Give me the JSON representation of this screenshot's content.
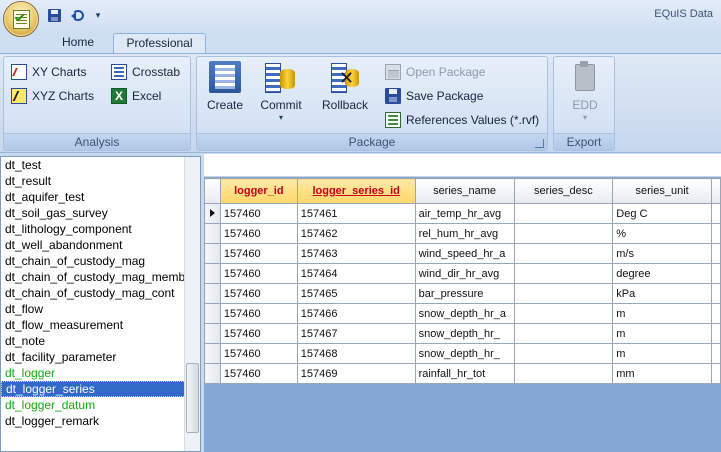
{
  "app": {
    "title": "EQuIS Data",
    "qat_more": "▾"
  },
  "tabs": [
    {
      "label": "Home"
    },
    {
      "label": "Professional"
    }
  ],
  "ribbon": {
    "analysis": {
      "label": "Analysis",
      "xy_charts": "XY Charts",
      "xyz_charts": "XYZ Charts",
      "crosstab": "Crosstab",
      "excel": "Excel"
    },
    "package": {
      "label": "Package",
      "create": "Create",
      "commit": "Commit",
      "commit_arrow": "▾",
      "rollback": "Rollback",
      "open_package": "Open Package",
      "save_package": "Save Package",
      "references_values": "References Values (*.rvf)"
    },
    "export": {
      "label": "Export",
      "edd": "EDD",
      "edd_arrow": "▾"
    }
  },
  "table_list": {
    "items": [
      {
        "label": "dt_test",
        "style": "normal"
      },
      {
        "label": "dt_result",
        "style": "normal"
      },
      {
        "label": "dt_aquifer_test",
        "style": "normal"
      },
      {
        "label": "dt_soil_gas_survey",
        "style": "normal"
      },
      {
        "label": "dt_lithology_component",
        "style": "normal"
      },
      {
        "label": "dt_well_abandonment",
        "style": "normal"
      },
      {
        "label": "dt_chain_of_custody_mag",
        "style": "normal"
      },
      {
        "label": "dt_chain_of_custody_mag_membe",
        "style": "normal"
      },
      {
        "label": "dt_chain_of_custody_mag_cont",
        "style": "normal"
      },
      {
        "label": "dt_flow",
        "style": "normal"
      },
      {
        "label": "dt_flow_measurement",
        "style": "normal"
      },
      {
        "label": "dt_note",
        "style": "normal"
      },
      {
        "label": "dt_facility_parameter",
        "style": "normal"
      },
      {
        "label": "dt_logger",
        "style": "green"
      },
      {
        "label": "dt_logger_series",
        "style": "selected"
      },
      {
        "label": "dt_logger_datum",
        "style": "green"
      },
      {
        "label": "dt_logger_remark",
        "style": "normal"
      }
    ]
  },
  "grid": {
    "columns": [
      "logger_id",
      "logger_series_id",
      "series_name",
      "series_desc",
      "series_unit"
    ],
    "current_row": 0,
    "rows": [
      [
        "157460",
        "157461",
        "air_temp_hr_avg",
        "",
        "Deg C"
      ],
      [
        "157460",
        "157462",
        "rel_hum_hr_avg",
        "",
        "%"
      ],
      [
        "157460",
        "157463",
        "wind_speed_hr_a",
        "",
        "m/s"
      ],
      [
        "157460",
        "157464",
        "wind_dir_hr_avg",
        "",
        "degree"
      ],
      [
        "157460",
        "157465",
        "bar_pressure",
        "",
        "kPa"
      ],
      [
        "157460",
        "157466",
        "snow_depth_hr_a",
        "",
        "m"
      ],
      [
        "157460",
        "157467",
        "snow_depth_hr_",
        "",
        "m"
      ],
      [
        "157460",
        "157468",
        "snow_depth_hr_",
        "",
        "m"
      ],
      [
        "157460",
        "157469",
        "rainfall_hr_tot",
        "",
        "mm"
      ]
    ]
  }
}
